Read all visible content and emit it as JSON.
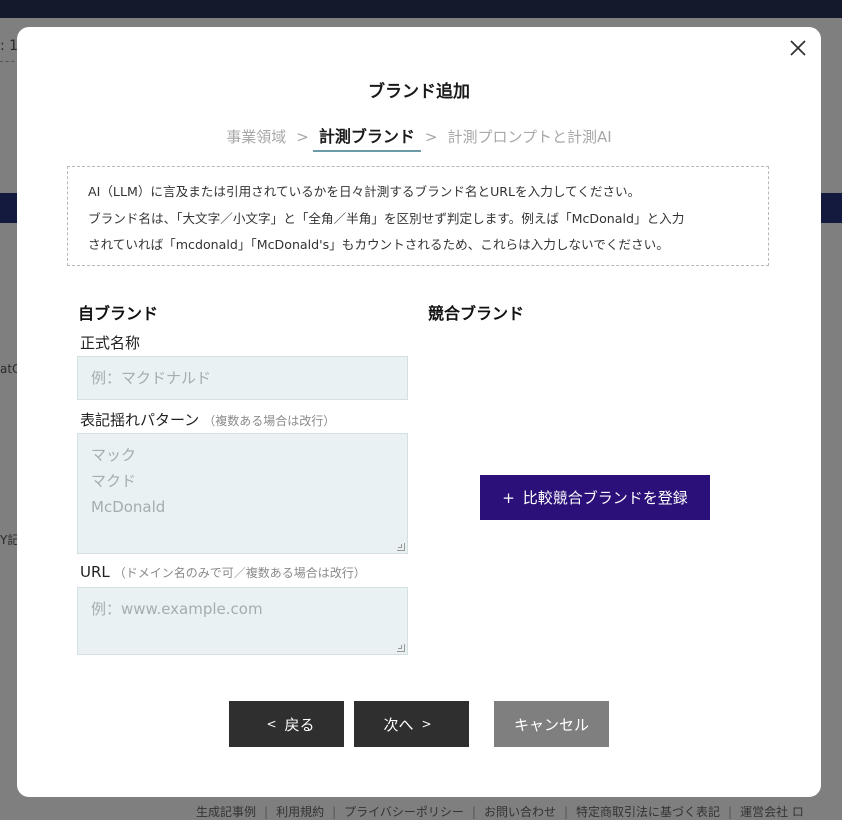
{
  "background": {
    "fragments": [
      ": 1",
      "atC",
      "Y記"
    ],
    "footer_links": [
      "生成記事例",
      "利用規約",
      "プライバシーポリシー",
      "お問い合わせ",
      "特定商取引法に基づく表記",
      "運営会社 ロ"
    ]
  },
  "modal": {
    "title": "ブランド追加",
    "close_icon": "close-icon",
    "steps": [
      {
        "label": "事業領域",
        "active": false
      },
      {
        "label": "計測ブランド",
        "active": true
      },
      {
        "label": "計測プロンプトと計測AI",
        "active": false
      }
    ],
    "step_separator": ">",
    "notice": [
      "AI（LLM）に言及または引用されているかを日々計測するブランド名とURLを入力してください。",
      "ブランド名は、「大文字／小文字」と「全角／半角」を区別せず判定します。例えば「McDonald」と入力",
      "されていれば「mcdonald」「McDonald's」もカウントされるため、これらは入力しないでください。"
    ],
    "own_brand": {
      "heading": "自ブランド",
      "official_name": {
        "label": "正式名称",
        "placeholder": "例：マクドナルド"
      },
      "variants": {
        "label": "表記揺れパターン",
        "hint": "（複数ある場合は改行）",
        "placeholder_lines": [
          "マック",
          "マクド",
          "McDonald"
        ]
      },
      "url": {
        "label": "URL",
        "hint": "（ドメイン名のみで可／複数ある場合は改行）",
        "placeholder": "例：www.example.com"
      }
    },
    "competitors": {
      "heading": "競合ブランド",
      "add_button": {
        "icon": "+",
        "label": "比較競合ブランドを登録"
      }
    },
    "buttons": {
      "back": {
        "chevron": "<",
        "label": "戻る"
      },
      "next": {
        "label": "次へ",
        "chevron": ">"
      },
      "cancel": {
        "label": "キャンセル"
      }
    },
    "colors": {
      "primary": "#2b1079",
      "dark_button": "#2f2f2f",
      "cancel_button": "#7f7f7f",
      "input_bg": "#e9f1f2",
      "active_step_underline": "#6b9aa8"
    }
  }
}
